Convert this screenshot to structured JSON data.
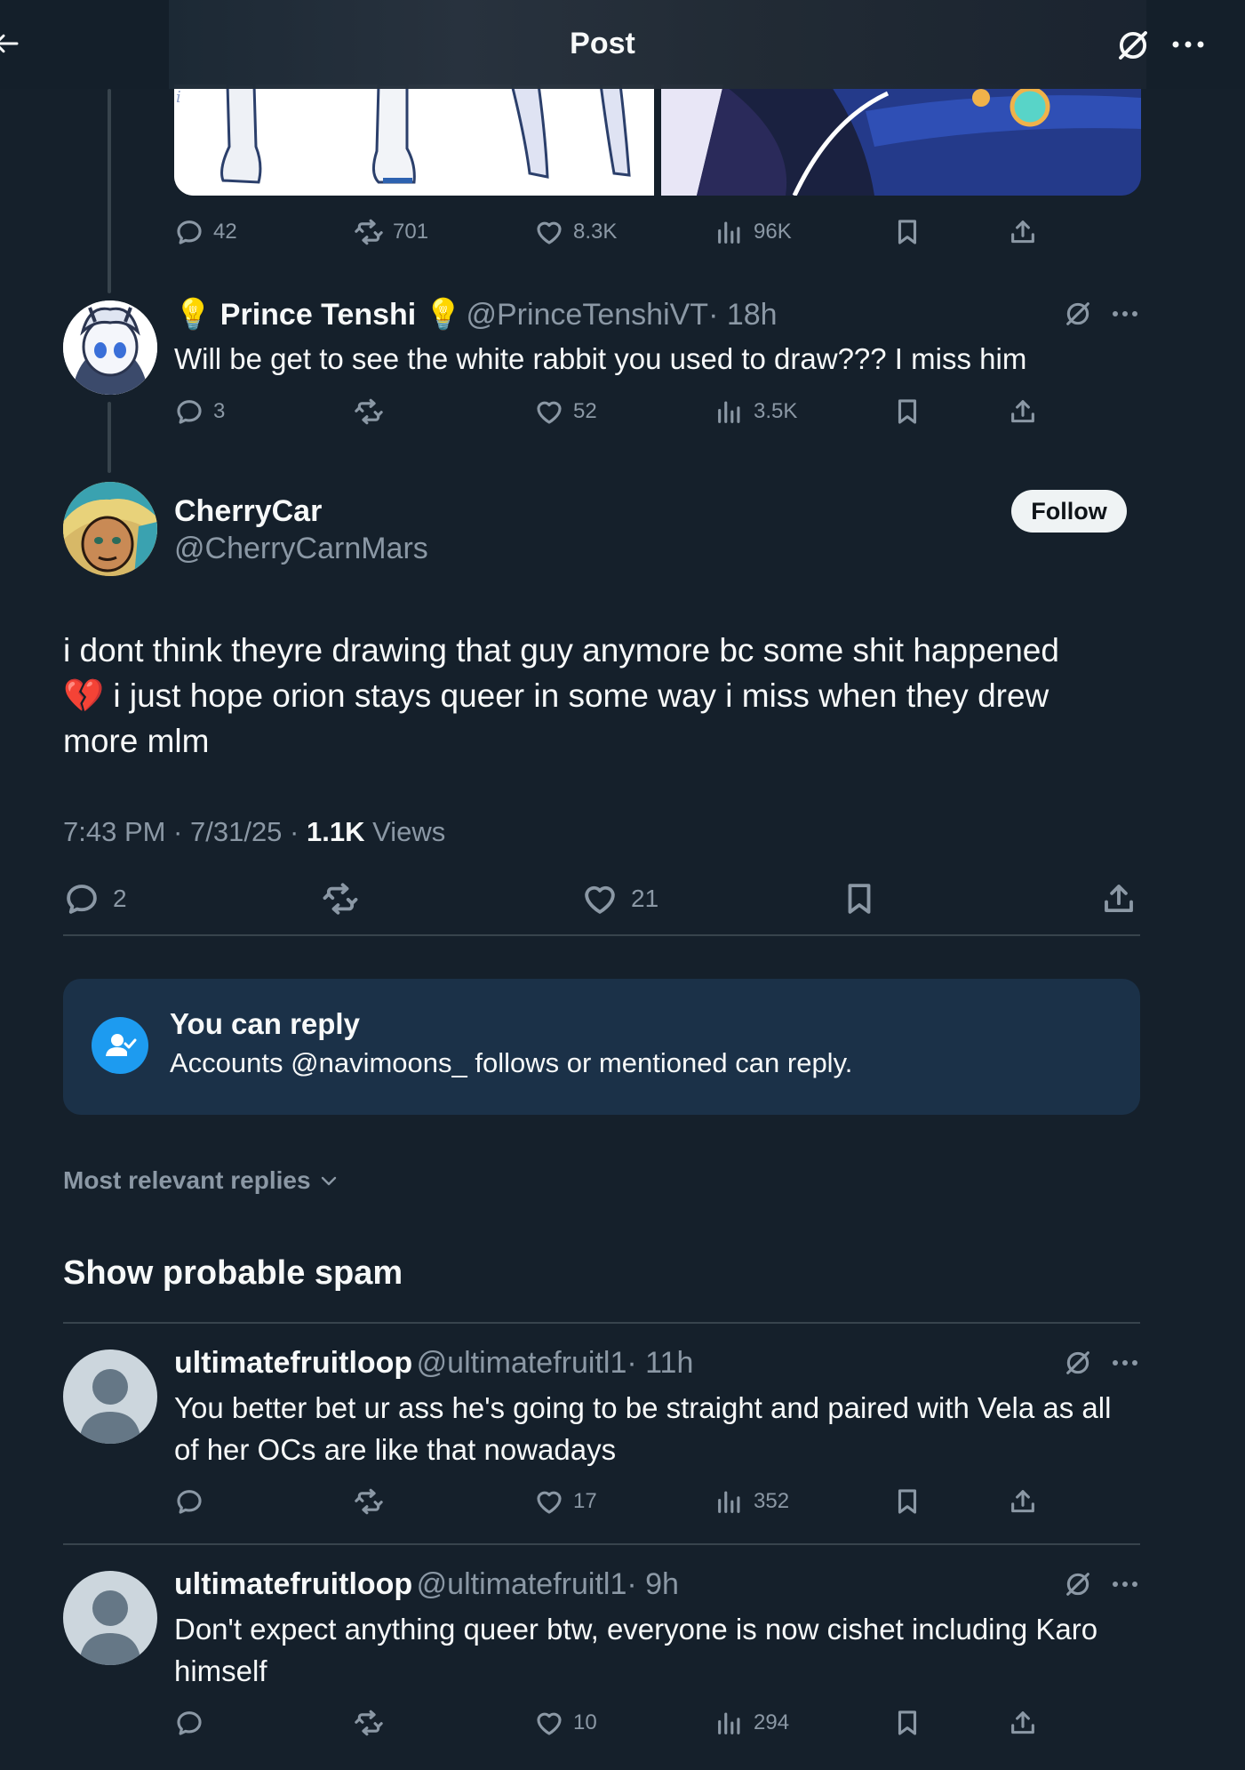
{
  "header": {
    "title": "Post"
  },
  "top_post_actions": {
    "replies": "42",
    "reposts": "701",
    "likes": "8.3K",
    "views": "96K"
  },
  "reply1": {
    "name": "💡 Prince Tenshi 💡",
    "handle": "@PrinceTenshiVT",
    "time": "· 18h",
    "text": "Will be get to see the white rabbit you used to draw??? I miss him",
    "replies": "3",
    "likes": "52",
    "views": "3.5K"
  },
  "main_post": {
    "name": "CherryCar",
    "handle": "@CherryCarnMars",
    "follow_label": "Follow",
    "text_line1": "i dont think theyre drawing that guy anymore bc some shit happened",
    "text_line2": "💔 i just hope orion stays queer in some way i miss when they drew",
    "text_line3": "more mlm",
    "time": "7:43 PM · 7/31/25 · ",
    "views_count": "1.1K",
    "views_label": " Views",
    "replies": "2",
    "likes": "21"
  },
  "reply_notice": {
    "title": "You can reply",
    "subtitle": "Accounts @navimoons_ follows or mentioned can reply."
  },
  "sort": {
    "label": "Most relevant replies"
  },
  "spam": {
    "label": "Show probable spam"
  },
  "replies": [
    {
      "name": "ultimatefruitloop",
      "handle": "@ultimatefruitl1",
      "time": "· 11h",
      "text_line1": "You better bet ur ass he's going to be straight and paired with Vela as all",
      "text_line2": "of her OCs are like that nowadays",
      "likes": "17",
      "views": "352"
    },
    {
      "name": "ultimatefruitloop",
      "handle": "@ultimatefruitl1",
      "time": "· 9h",
      "text_line1": "Don't expect anything queer btw, everyone is now cishet including Karo",
      "text_line2": "himself",
      "likes": "10",
      "views": "294"
    }
  ],
  "colors": {
    "background": "#15202b",
    "accent": "#1d9bf0",
    "secondary_text": "#8b98a5",
    "reply_box": "#1b3148"
  }
}
